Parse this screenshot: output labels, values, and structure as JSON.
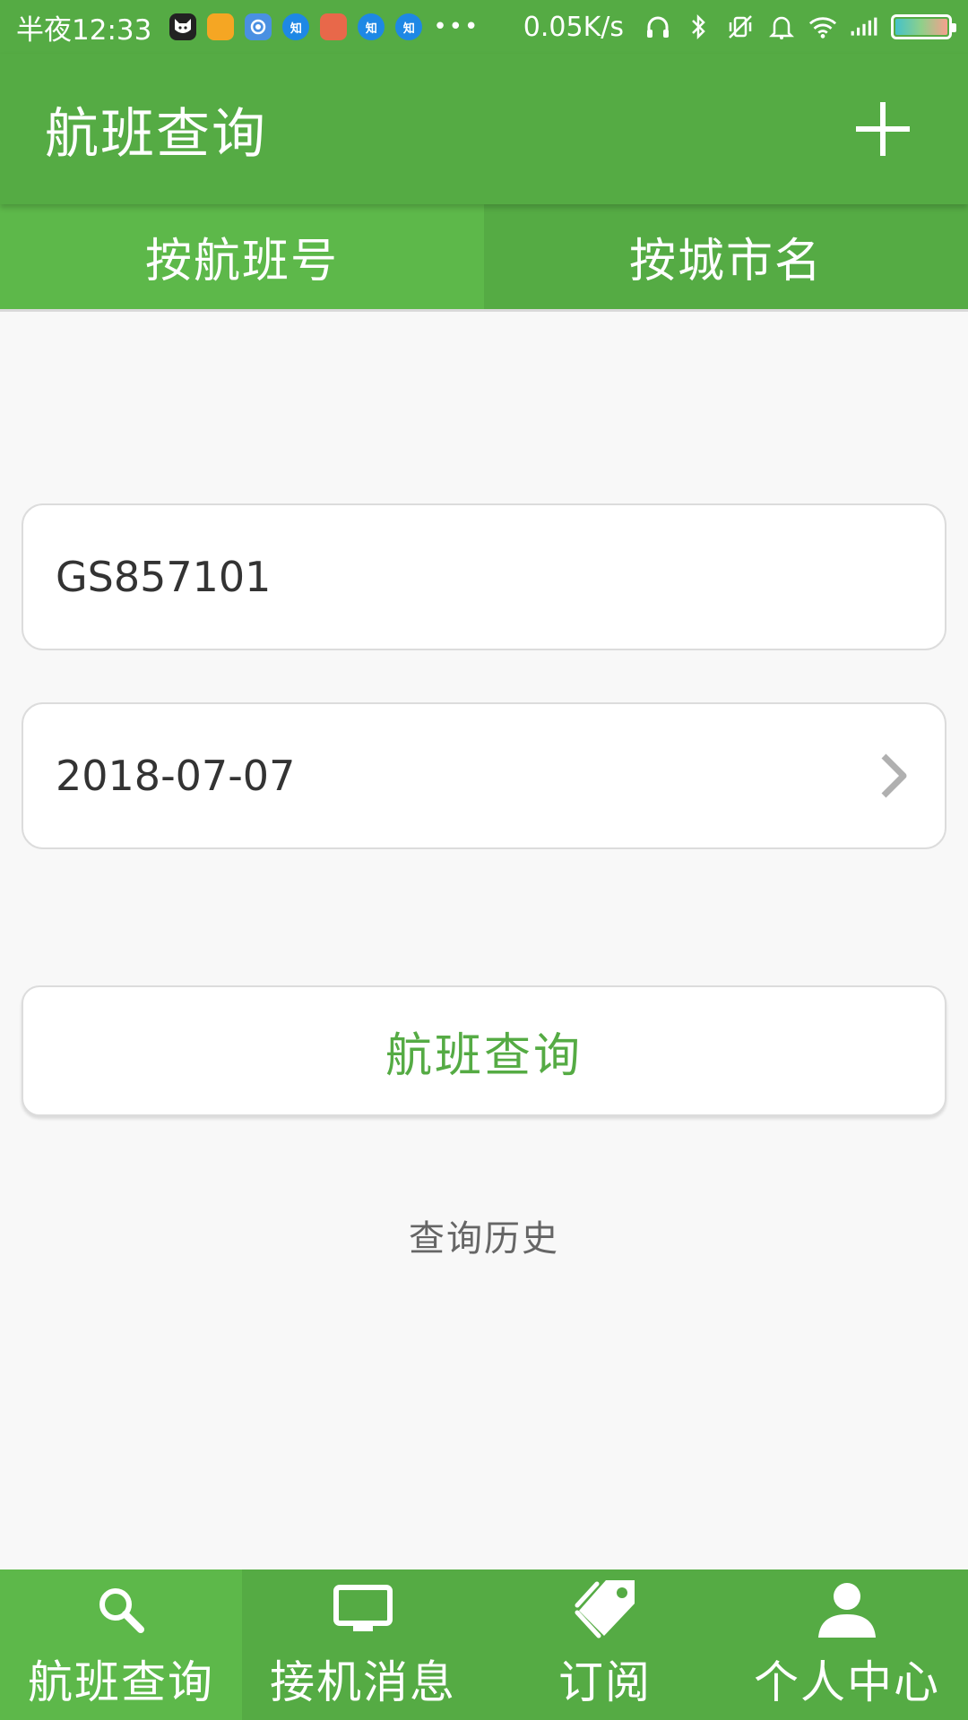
{
  "status_bar": {
    "time": "半夜12:33",
    "speed": "0.05K/s",
    "more": "•••",
    "notifications": [
      {
        "name": "cat-app-icon",
        "label": "",
        "color": "#ffffff"
      },
      {
        "name": "orange-app-icon",
        "label": "",
        "color": "#f5a623"
      },
      {
        "name": "blue-camera-app-icon",
        "label": "",
        "color": "#4a90e2"
      },
      {
        "name": "zhihu-icon",
        "label": "知",
        "color": "#1e88e5"
      },
      {
        "name": "shopping-app-icon",
        "label": "",
        "color": "#e8684a"
      },
      {
        "name": "zhihu-icon-2",
        "label": "知",
        "color": "#1e88e5"
      },
      {
        "name": "zhihu-icon-3",
        "label": "知",
        "color": "#1e88e5"
      }
    ]
  },
  "app_bar": {
    "title": "航班查询",
    "add_icon": "plus-icon"
  },
  "tabs": [
    {
      "label": "按航班号",
      "active": true
    },
    {
      "label": "按城市名",
      "active": false
    }
  ],
  "form": {
    "flight_number": "GS857101",
    "date": "2018-07-07",
    "search_label": "航班查询",
    "history_label": "查询历史"
  },
  "bottom_nav": [
    {
      "label": "航班查询",
      "icon": "search-icon",
      "active": true
    },
    {
      "label": "接机消息",
      "icon": "monitor-icon",
      "active": false
    },
    {
      "label": "订阅",
      "icon": "tag-icon",
      "active": false
    },
    {
      "label": "个人中心",
      "icon": "person-icon",
      "active": false
    }
  ],
  "colors": {
    "primary": "#55ab44",
    "active_tab": "#5db84a",
    "background": "#f8f8f8"
  }
}
